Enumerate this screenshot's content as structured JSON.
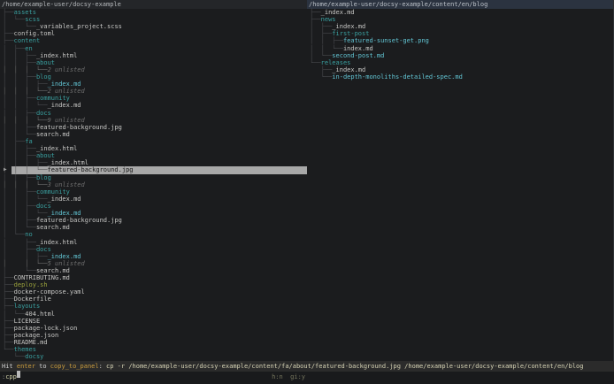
{
  "left_panel": {
    "title": "/home/example-user/docsy-example",
    "rows": [
      {
        "prefix": "├──",
        "name": "assets",
        "type": "dir"
      },
      {
        "prefix": "│  └──",
        "name": "scss",
        "type": "dir"
      },
      {
        "prefix": "│     └──",
        "name": "_variables_project.scss",
        "type": "file"
      },
      {
        "prefix": "├──",
        "name": "config.toml",
        "type": "file"
      },
      {
        "prefix": "├──",
        "name": "content",
        "type": "dir"
      },
      {
        "prefix": "│  ├──",
        "name": "en",
        "type": "dir"
      },
      {
        "prefix": "│  │  ├──",
        "name": "_index.html",
        "type": "file"
      },
      {
        "prefix": "│  │  ├──",
        "name": "about",
        "type": "dir"
      },
      {
        "prefix": "│  │  │  └──",
        "name": "2 unlisted",
        "type": "unlisted"
      },
      {
        "prefix": "│  │  ├──",
        "name": "blog",
        "type": "dir"
      },
      {
        "prefix": "│  │  │  ├──",
        "name": "_index.md",
        "type": "special"
      },
      {
        "prefix": "│  │  │  └──",
        "name": "2 unlisted",
        "type": "unlisted"
      },
      {
        "prefix": "│  │  ├──",
        "name": "community",
        "type": "dir"
      },
      {
        "prefix": "│  │  │  └──",
        "name": "_index.md",
        "type": "file"
      },
      {
        "prefix": "│  │  ├──",
        "name": "docs",
        "type": "dir"
      },
      {
        "prefix": "│  │  │  └──",
        "name": "9 unlisted",
        "type": "unlisted"
      },
      {
        "prefix": "│  │  ├──",
        "name": "featured-background.jpg",
        "type": "file"
      },
      {
        "prefix": "│  │  └──",
        "name": "search.md",
        "type": "file"
      },
      {
        "prefix": "│  ├──",
        "name": "fa",
        "type": "dir"
      },
      {
        "prefix": "│  │  ├──",
        "name": "_index.html",
        "type": "file"
      },
      {
        "prefix": "│  │  ├──",
        "name": "about",
        "type": "dir"
      },
      {
        "prefix": "│  │  │  ├──",
        "name": "_index.html",
        "type": "file"
      },
      {
        "prefix": "│  │  │  └──",
        "name": "featured-background.jpg",
        "type": "file",
        "selected": true
      },
      {
        "prefix": "│  │  ├──",
        "name": "blog",
        "type": "dir"
      },
      {
        "prefix": "│  │  │  └──",
        "name": "3 unlisted",
        "type": "unlisted"
      },
      {
        "prefix": "│  │  ├──",
        "name": "community",
        "type": "dir"
      },
      {
        "prefix": "│  │  │  └──",
        "name": "_index.md",
        "type": "file"
      },
      {
        "prefix": "│  │  ├──",
        "name": "docs",
        "type": "dir"
      },
      {
        "prefix": "│  │  │  └──",
        "name": "_index.md",
        "type": "special"
      },
      {
        "prefix": "│  │  ├──",
        "name": "featured-background.jpg",
        "type": "file"
      },
      {
        "prefix": "│  │  └──",
        "name": "search.md",
        "type": "file"
      },
      {
        "prefix": "│  └──",
        "name": "no",
        "type": "dir"
      },
      {
        "prefix": "│     ├──",
        "name": "_index.html",
        "type": "file"
      },
      {
        "prefix": "│     ├──",
        "name": "docs",
        "type": "dir"
      },
      {
        "prefix": "│     │  ├──",
        "name": "_index.md",
        "type": "special"
      },
      {
        "prefix": "│     │  └──",
        "name": "5 unlisted",
        "type": "unlisted"
      },
      {
        "prefix": "│     └──",
        "name": "search.md",
        "type": "file"
      },
      {
        "prefix": "├──",
        "name": "CONTRIBUTING.md",
        "type": "file"
      },
      {
        "prefix": "├──",
        "name": "deploy.sh",
        "type": "exec"
      },
      {
        "prefix": "├──",
        "name": "docker-compose.yaml",
        "type": "file"
      },
      {
        "prefix": "├──",
        "name": "Dockerfile",
        "type": "file"
      },
      {
        "prefix": "├──",
        "name": "layouts",
        "type": "dir"
      },
      {
        "prefix": "│  └──",
        "name": "404.html",
        "type": "file"
      },
      {
        "prefix": "├──",
        "name": "LICENSE",
        "type": "file"
      },
      {
        "prefix": "├──",
        "name": "package-lock.json",
        "type": "file"
      },
      {
        "prefix": "├──",
        "name": "package.json",
        "type": "file"
      },
      {
        "prefix": "├──",
        "name": "README.md",
        "type": "file"
      },
      {
        "prefix": "└──",
        "name": "themes",
        "type": "dir"
      },
      {
        "prefix": "   └──",
        "name": "docsy",
        "type": "dir"
      }
    ]
  },
  "right_panel": {
    "title": "/home/example-user/docsy-example/content/en/blog",
    "rows": [
      {
        "prefix": "├──",
        "name": "_index.md",
        "type": "file"
      },
      {
        "prefix": "├──",
        "name": "news",
        "type": "dir"
      },
      {
        "prefix": "│  ├──",
        "name": "_index.md",
        "type": "file"
      },
      {
        "prefix": "│  ├──",
        "name": "first-post",
        "type": "dir"
      },
      {
        "prefix": "│  │  ├──",
        "name": "featured-sunset-get.png",
        "type": "special"
      },
      {
        "prefix": "│  │  └──",
        "name": "index.md",
        "type": "file"
      },
      {
        "prefix": "│  └──",
        "name": "second-post.md",
        "type": "special"
      },
      {
        "prefix": "└──",
        "name": "releases",
        "type": "dir"
      },
      {
        "prefix": "   ├──",
        "name": "_index.md",
        "type": "file"
      },
      {
        "prefix": "   └──",
        "name": "in-depth-monoliths-detailed-spec.md",
        "type": "special"
      }
    ]
  },
  "status_bar": {
    "segments": [
      {
        "text": "Hit ",
        "style": "plain"
      },
      {
        "text": "enter",
        "style": "key"
      },
      {
        "text": " to ",
        "style": "plain"
      },
      {
        "text": "copy_to_panel",
        "style": "key"
      },
      {
        "text": ": ",
        "style": "plain"
      },
      {
        "text": "cp -r /home/example-user/docsy-example/content/fa/about/featured-background.jpg /home/example-user/docsy-example/content/en/blog",
        "style": "cmd"
      }
    ]
  },
  "input_line": {
    "prompt": ":",
    "value": "cpp",
    "flags": "h:n  gi:y"
  },
  "selection_marker_icon": "▶",
  "colors": {
    "background": "#1b1c1e",
    "directory": "#3aa0a0",
    "file": "#c7c7c5",
    "special_file": "#62c5d4",
    "executable": "#9aa13c",
    "unlisted": "#6e6e6e",
    "branch": "#4b4d50",
    "selected_row_bg": "#a8a8a8",
    "selected_row_text": "#141414",
    "status_bg": "#2b2b2b",
    "status_key": "#c89b3d",
    "right_title_bg": "#2b3340",
    "left_title_bg": "#242629"
  }
}
